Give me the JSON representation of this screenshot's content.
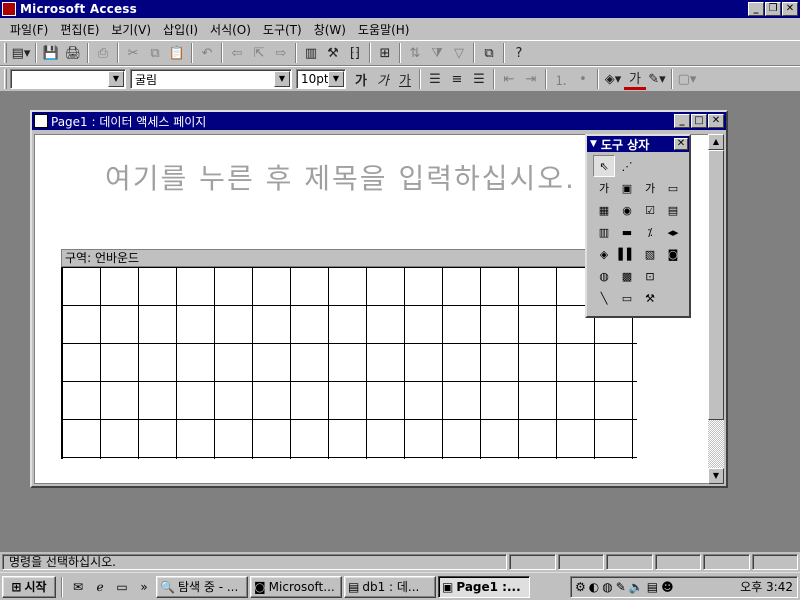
{
  "app": {
    "title": "Microsoft Access"
  },
  "menu": [
    "파일(F)",
    "편집(E)",
    "보기(V)",
    "삽입(I)",
    "서식(O)",
    "도구(T)",
    "창(W)",
    "도움말(H)"
  ],
  "format_bar": {
    "style_value": "",
    "font_value": "굴림",
    "size_value": "10pt",
    "bold_label": "가",
    "italic_label": "가",
    "underline_label": "가",
    "font_color_label": "가"
  },
  "child_window": {
    "title": "Page1 : 데이터 액세스 페이지",
    "title_placeholder": "여기를 누른 후 제목을 입력하십시오.",
    "section_label": "구역: 언바운드"
  },
  "toolbox": {
    "title": "도구 상자",
    "rows": [
      [
        "pointer-icon",
        "wand-icon"
      ],
      [
        "label-icon",
        "bound-span-icon",
        "textbox-icon",
        "command-button-icon"
      ],
      [
        "scrolling-text-icon",
        "option-button-icon",
        "checkbox-icon",
        "listbox-icon"
      ],
      [
        "dropdown-icon",
        "button-icon",
        "expand-icon",
        "record-nav-icon"
      ],
      [
        "office-chart-icon",
        "office-spreadsheet-icon",
        "pivot-table-icon",
        "hyperlink-icon"
      ],
      [
        "image-hyperlink-icon",
        "movie-icon",
        "image-icon"
      ],
      [
        "line-icon",
        "rectangle-icon",
        "more-controls-icon"
      ]
    ],
    "row_glyphs": [
      [
        "⇖",
        "⋰"
      ],
      [
        "가",
        "▣",
        "가",
        "▭"
      ],
      [
        "▦",
        "◉",
        "☑",
        "▤"
      ],
      [
        "▥",
        "▬",
        "⁒",
        "◂▸"
      ],
      [
        "◈",
        "▌▌",
        "▧",
        "◙"
      ],
      [
        "◍",
        "▩",
        "⊡",
        "▨"
      ],
      [
        "╲",
        "▭",
        "⚒"
      ]
    ]
  },
  "status": {
    "text": "명령을 선택하십시오."
  },
  "taskbar": {
    "start_label": "시작",
    "tasks": [
      "탐색 중 - ...",
      "Microsoft...",
      "db1 : 데...",
      "Page1 :..."
    ],
    "clock": "오후 3:42"
  }
}
